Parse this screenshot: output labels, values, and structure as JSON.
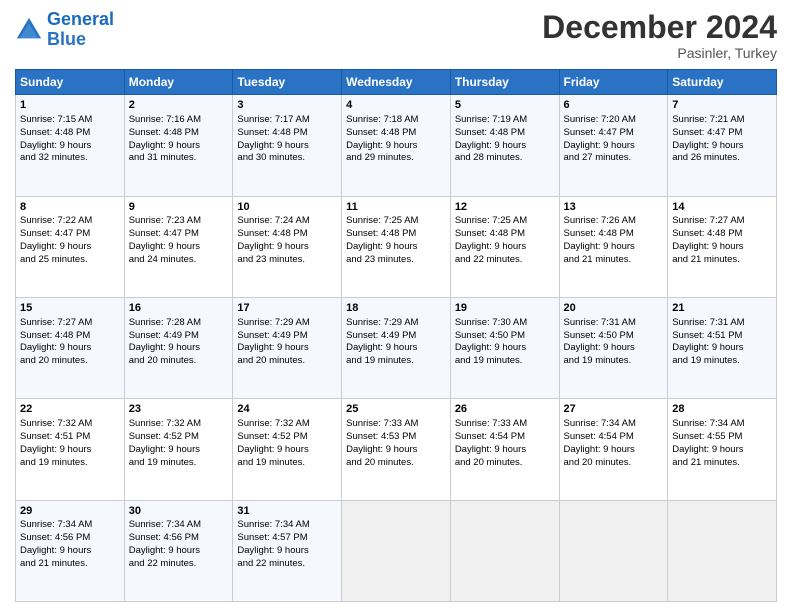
{
  "header": {
    "logo_line1": "General",
    "logo_line2": "Blue",
    "month_title": "December 2024",
    "location": "Pasinler, Turkey"
  },
  "days_of_week": [
    "Sunday",
    "Monday",
    "Tuesday",
    "Wednesday",
    "Thursday",
    "Friday",
    "Saturday"
  ],
  "weeks": [
    [
      {
        "day": "1",
        "lines": [
          "Sunrise: 7:15 AM",
          "Sunset: 4:48 PM",
          "Daylight: 9 hours",
          "and 32 minutes."
        ]
      },
      {
        "day": "2",
        "lines": [
          "Sunrise: 7:16 AM",
          "Sunset: 4:48 PM",
          "Daylight: 9 hours",
          "and 31 minutes."
        ]
      },
      {
        "day": "3",
        "lines": [
          "Sunrise: 7:17 AM",
          "Sunset: 4:48 PM",
          "Daylight: 9 hours",
          "and 30 minutes."
        ]
      },
      {
        "day": "4",
        "lines": [
          "Sunrise: 7:18 AM",
          "Sunset: 4:48 PM",
          "Daylight: 9 hours",
          "and 29 minutes."
        ]
      },
      {
        "day": "5",
        "lines": [
          "Sunrise: 7:19 AM",
          "Sunset: 4:48 PM",
          "Daylight: 9 hours",
          "and 28 minutes."
        ]
      },
      {
        "day": "6",
        "lines": [
          "Sunrise: 7:20 AM",
          "Sunset: 4:47 PM",
          "Daylight: 9 hours",
          "and 27 minutes."
        ]
      },
      {
        "day": "7",
        "lines": [
          "Sunrise: 7:21 AM",
          "Sunset: 4:47 PM",
          "Daylight: 9 hours",
          "and 26 minutes."
        ]
      }
    ],
    [
      {
        "day": "8",
        "lines": [
          "Sunrise: 7:22 AM",
          "Sunset: 4:47 PM",
          "Daylight: 9 hours",
          "and 25 minutes."
        ]
      },
      {
        "day": "9",
        "lines": [
          "Sunrise: 7:23 AM",
          "Sunset: 4:47 PM",
          "Daylight: 9 hours",
          "and 24 minutes."
        ]
      },
      {
        "day": "10",
        "lines": [
          "Sunrise: 7:24 AM",
          "Sunset: 4:48 PM",
          "Daylight: 9 hours",
          "and 23 minutes."
        ]
      },
      {
        "day": "11",
        "lines": [
          "Sunrise: 7:25 AM",
          "Sunset: 4:48 PM",
          "Daylight: 9 hours",
          "and 23 minutes."
        ]
      },
      {
        "day": "12",
        "lines": [
          "Sunrise: 7:25 AM",
          "Sunset: 4:48 PM",
          "Daylight: 9 hours",
          "and 22 minutes."
        ]
      },
      {
        "day": "13",
        "lines": [
          "Sunrise: 7:26 AM",
          "Sunset: 4:48 PM",
          "Daylight: 9 hours",
          "and 21 minutes."
        ]
      },
      {
        "day": "14",
        "lines": [
          "Sunrise: 7:27 AM",
          "Sunset: 4:48 PM",
          "Daylight: 9 hours",
          "and 21 minutes."
        ]
      }
    ],
    [
      {
        "day": "15",
        "lines": [
          "Sunrise: 7:27 AM",
          "Sunset: 4:48 PM",
          "Daylight: 9 hours",
          "and 20 minutes."
        ]
      },
      {
        "day": "16",
        "lines": [
          "Sunrise: 7:28 AM",
          "Sunset: 4:49 PM",
          "Daylight: 9 hours",
          "and 20 minutes."
        ]
      },
      {
        "day": "17",
        "lines": [
          "Sunrise: 7:29 AM",
          "Sunset: 4:49 PM",
          "Daylight: 9 hours",
          "and 20 minutes."
        ]
      },
      {
        "day": "18",
        "lines": [
          "Sunrise: 7:29 AM",
          "Sunset: 4:49 PM",
          "Daylight: 9 hours",
          "and 19 minutes."
        ]
      },
      {
        "day": "19",
        "lines": [
          "Sunrise: 7:30 AM",
          "Sunset: 4:50 PM",
          "Daylight: 9 hours",
          "and 19 minutes."
        ]
      },
      {
        "day": "20",
        "lines": [
          "Sunrise: 7:31 AM",
          "Sunset: 4:50 PM",
          "Daylight: 9 hours",
          "and 19 minutes."
        ]
      },
      {
        "day": "21",
        "lines": [
          "Sunrise: 7:31 AM",
          "Sunset: 4:51 PM",
          "Daylight: 9 hours",
          "and 19 minutes."
        ]
      }
    ],
    [
      {
        "day": "22",
        "lines": [
          "Sunrise: 7:32 AM",
          "Sunset: 4:51 PM",
          "Daylight: 9 hours",
          "and 19 minutes."
        ]
      },
      {
        "day": "23",
        "lines": [
          "Sunrise: 7:32 AM",
          "Sunset: 4:52 PM",
          "Daylight: 9 hours",
          "and 19 minutes."
        ]
      },
      {
        "day": "24",
        "lines": [
          "Sunrise: 7:32 AM",
          "Sunset: 4:52 PM",
          "Daylight: 9 hours",
          "and 19 minutes."
        ]
      },
      {
        "day": "25",
        "lines": [
          "Sunrise: 7:33 AM",
          "Sunset: 4:53 PM",
          "Daylight: 9 hours",
          "and 20 minutes."
        ]
      },
      {
        "day": "26",
        "lines": [
          "Sunrise: 7:33 AM",
          "Sunset: 4:54 PM",
          "Daylight: 9 hours",
          "and 20 minutes."
        ]
      },
      {
        "day": "27",
        "lines": [
          "Sunrise: 7:34 AM",
          "Sunset: 4:54 PM",
          "Daylight: 9 hours",
          "and 20 minutes."
        ]
      },
      {
        "day": "28",
        "lines": [
          "Sunrise: 7:34 AM",
          "Sunset: 4:55 PM",
          "Daylight: 9 hours",
          "and 21 minutes."
        ]
      }
    ],
    [
      {
        "day": "29",
        "lines": [
          "Sunrise: 7:34 AM",
          "Sunset: 4:56 PM",
          "Daylight: 9 hours",
          "and 21 minutes."
        ]
      },
      {
        "day": "30",
        "lines": [
          "Sunrise: 7:34 AM",
          "Sunset: 4:56 PM",
          "Daylight: 9 hours",
          "and 22 minutes."
        ]
      },
      {
        "day": "31",
        "lines": [
          "Sunrise: 7:34 AM",
          "Sunset: 4:57 PM",
          "Daylight: 9 hours",
          "and 22 minutes."
        ]
      },
      null,
      null,
      null,
      null
    ]
  ]
}
